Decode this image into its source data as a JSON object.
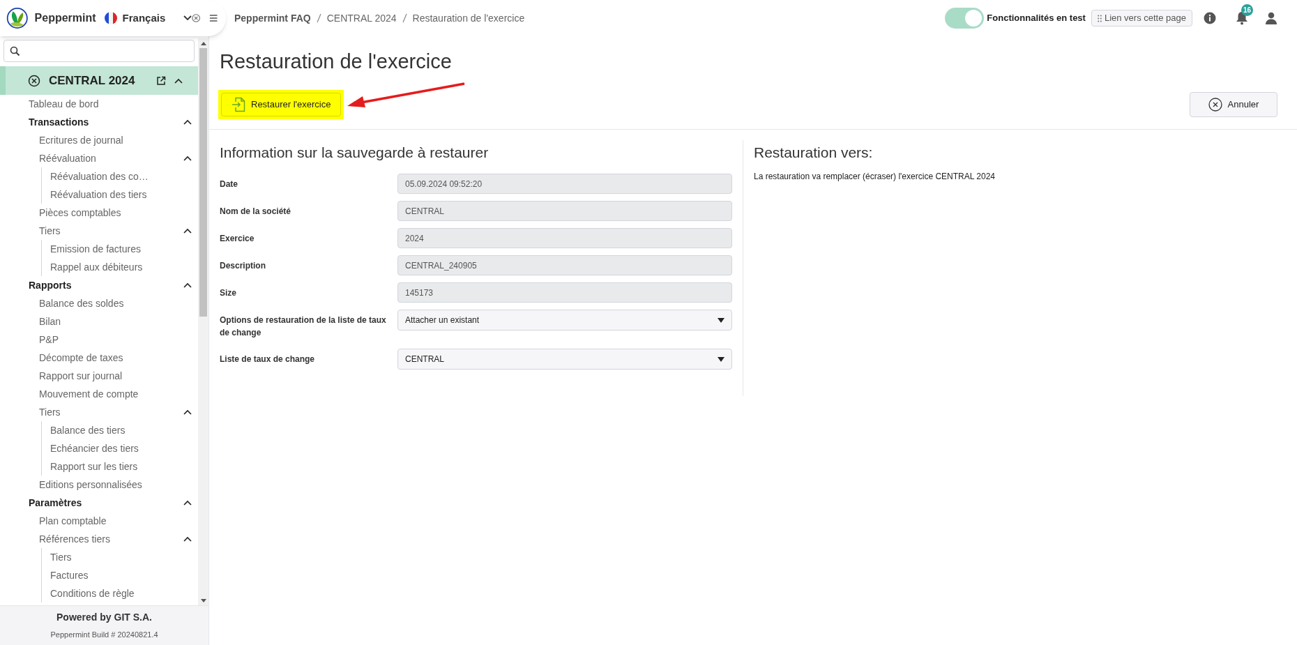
{
  "app": {
    "name": "Peppermint",
    "language": "Français"
  },
  "breadcrumb": [
    "Peppermint FAQ",
    "CENTRAL 2024",
    "Restauration de l'exercice"
  ],
  "top_bar": {
    "test_features": {
      "label": "Fonctionnalités en test",
      "on": true
    },
    "link_button": "Lien vers cette page",
    "notifications_badge": "16"
  },
  "sidebar": {
    "company": {
      "label": "CENTRAL 2024",
      "expanded": true
    },
    "items": [
      {
        "label": "Tableau de bord"
      },
      {
        "label": "Transactions",
        "expanded": true,
        "children": [
          {
            "label": "Ecritures de journal"
          },
          {
            "label": "Réévaluation",
            "expanded": true,
            "children": [
              {
                "label": "Réévaluation des co…"
              },
              {
                "label": "Réévaluation des tiers"
              }
            ]
          },
          {
            "label": "Pièces comptables"
          },
          {
            "label": "Tiers",
            "expanded": true,
            "children": [
              {
                "label": "Emission de factures"
              },
              {
                "label": "Rappel aux débiteurs"
              }
            ]
          }
        ]
      },
      {
        "label": "Rapports",
        "expanded": true,
        "children": [
          {
            "label": "Balance des soldes"
          },
          {
            "label": "Bilan"
          },
          {
            "label": "P&P"
          },
          {
            "label": "Décompte de taxes"
          },
          {
            "label": "Rapport sur journal"
          },
          {
            "label": "Mouvement de compte"
          },
          {
            "label": "Tiers",
            "expanded": true,
            "children": [
              {
                "label": "Balance des tiers"
              },
              {
                "label": "Echéancier des tiers"
              },
              {
                "label": "Rapport sur les tiers"
              }
            ]
          },
          {
            "label": "Editions personnalisées"
          }
        ]
      },
      {
        "label": "Paramètres",
        "expanded": true,
        "children": [
          {
            "label": "Plan comptable"
          },
          {
            "label": "Références tiers",
            "expanded": true,
            "children": [
              {
                "label": "Tiers"
              },
              {
                "label": "Factures"
              },
              {
                "label": "Conditions de règle"
              }
            ]
          }
        ]
      }
    ],
    "footer": {
      "powered_by": "Powered by GIT S.A.",
      "build": "Peppermint Build # 20240821.4"
    }
  },
  "page": {
    "title": "Restauration de l'exercice",
    "restore_button": "Restaurer l'exercice",
    "cancel_button": "Annuler",
    "backup_info": {
      "title": "Information sur la sauvegarde à restaurer",
      "fields": [
        {
          "kind": "text",
          "label": "Date",
          "value": "05.09.2024 09:52:20"
        },
        {
          "kind": "text",
          "label": "Nom de la société",
          "value": "CENTRAL"
        },
        {
          "kind": "text",
          "label": "Exercice",
          "value": "2024"
        },
        {
          "kind": "text",
          "label": "Description",
          "value": "CENTRAL_240905"
        },
        {
          "kind": "text",
          "label": "Size",
          "value": "145173"
        },
        {
          "kind": "select",
          "label": "Options de restauration de la liste de taux de change",
          "value": "Attacher un existant"
        },
        {
          "kind": "select",
          "label": "Liste de taux de change",
          "value": "CENTRAL"
        }
      ]
    },
    "restore_to": {
      "title": "Restauration vers:",
      "message": "La restauration va remplacer (écraser) l'exercice CENTRAL 2024"
    }
  }
}
